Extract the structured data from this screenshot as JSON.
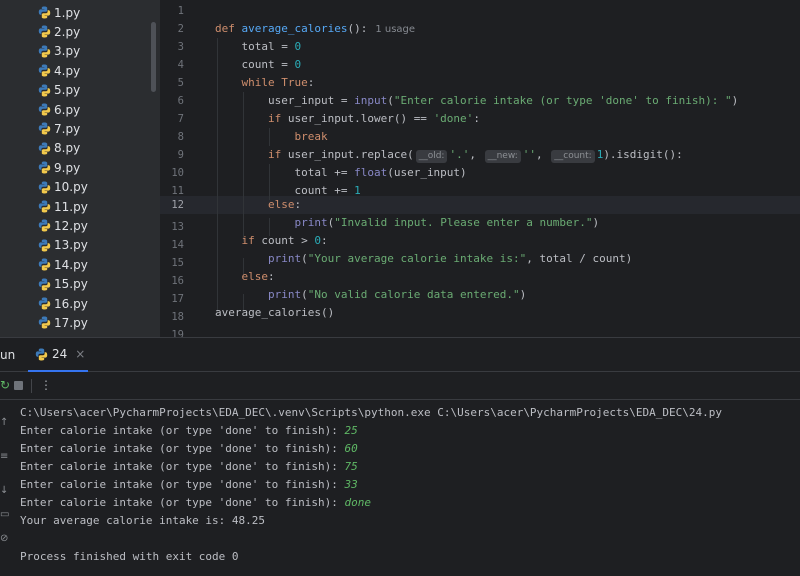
{
  "project_tree": {
    "files": [
      "1.py",
      "2.py",
      "3.py",
      "4.py",
      "5.py",
      "6.py",
      "7.py",
      "8.py",
      "9.py",
      "10.py",
      "11.py",
      "12.py",
      "13.py",
      "14.py",
      "15.py",
      "16.py",
      "17.py"
    ],
    "file_icon": "python-file-icon"
  },
  "editor": {
    "line_numbers": [
      "1",
      "2",
      "3",
      "4",
      "5",
      "6",
      "7",
      "8",
      "9",
      "10",
      "11",
      "12",
      "13",
      "14",
      "15",
      "16",
      "17",
      "18",
      "19"
    ],
    "current_line": "12",
    "usage_hint": "1 usage",
    "param_hints": {
      "old": "__old:",
      "new": "__new:",
      "count": "__count:"
    },
    "code": {
      "l2_def": "def ",
      "l2_name": "average_calories",
      "l2_rest": "():",
      "l3_a": "    total = ",
      "l3_b": "0",
      "l4_a": "    count = ",
      "l4_b": "0",
      "l5_a": "    ",
      "l5_kw": "while ",
      "l5_true": "True",
      "l5_rest": ":",
      "l6_a": "        user_input = ",
      "l6_fn": "input",
      "l6_b": "(",
      "l6_str": "\"Enter calorie intake (or type 'done' to finish): \"",
      "l6_c": ")",
      "l7_a": "        ",
      "l7_kw": "if ",
      "l7_b": "user_input.lower() == ",
      "l7_str": "'done'",
      "l7_c": ":",
      "l8_a": "            ",
      "l8_kw": "break",
      "l9_a": "        ",
      "l9_kw": "if ",
      "l9_b": "user_input.replace(",
      "l9_s1": "'.'",
      "l9_c": ", ",
      "l9_s2": "''",
      "l9_d": ", ",
      "l9_n": "1",
      "l9_e": ").isdigit():",
      "l10_a": "            total += ",
      "l10_fn": "float",
      "l10_b": "(user_input)",
      "l11_a": "            count += ",
      "l11_n": "1",
      "l12_a": "        ",
      "l12_kw": "else",
      "l12_b": ":",
      "l13_a": "            ",
      "l13_fn": "print",
      "l13_b": "(",
      "l13_str": "\"Invalid input. Please enter a number.\"",
      "l13_c": ")",
      "l14_a": "    ",
      "l14_kw": "if ",
      "l14_b": "count > ",
      "l14_n": "0",
      "l14_c": ":",
      "l15_a": "        ",
      "l15_fn": "print",
      "l15_b": "(",
      "l15_str": "\"Your average calorie intake is:\"",
      "l15_c": ", total / count)",
      "l16_a": "    ",
      "l16_kw": "else",
      "l16_b": ":",
      "l17_a": "        ",
      "l17_fn": "print",
      "l17_b": "(",
      "l17_str": "\"No valid calorie data entered.\"",
      "l17_c": ")",
      "l18_a": "average_calories()"
    }
  },
  "run_panel": {
    "title": "un",
    "tab_label": "24",
    "tab_close": "×",
    "more_icon": "⋮",
    "console": {
      "cmd": "C:\\Users\\acer\\PycharmProjects\\EDA_DEC\\.venv\\Scripts\\python.exe C:\\Users\\acer\\PycharmProjects\\EDA_DEC\\24.py",
      "prompt": "Enter calorie intake (or type 'done' to finish): ",
      "inputs": [
        "25",
        "60",
        "75",
        "33",
        "done"
      ],
      "result": "Your average calorie intake is: 48.25",
      "exit": "Process finished with exit code 0"
    }
  },
  "colors": {
    "keyword": "#cf8e6d",
    "function": "#56a8f5",
    "number": "#2aacb8",
    "string": "#6aab73",
    "builtin": "#8888c6",
    "console_input": "#5fb865",
    "accent": "#3574f0"
  }
}
